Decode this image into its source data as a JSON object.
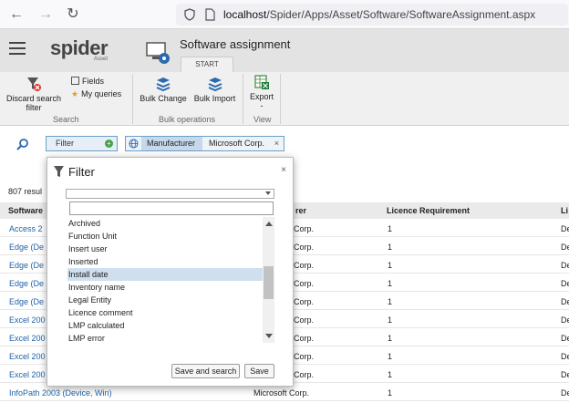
{
  "browser": {
    "url_prefix": "localhost",
    "url_path": "/Spider/Apps/Asset/Software/SoftwareAssignment.aspx"
  },
  "header": {
    "logo": "spider",
    "logo_sub": "Asset",
    "title": "Software assignment",
    "tab": "START"
  },
  "ribbon": {
    "discard_label_1": "Discard search",
    "discard_label_2": "filter",
    "fields_label": "Fields",
    "queries_label": "My queries",
    "search_group": "Search",
    "bulk_change": "Bulk Change",
    "bulk_import": "Bulk Import",
    "bulk_group": "Bulk operations",
    "export_label": "Export",
    "export_dash": "-",
    "view_group": "View"
  },
  "filterbar": {
    "filter_label": "Filter",
    "manufacturer_key": "Manufacturer",
    "manufacturer_value": "Microsoft Corp.",
    "remove": "×"
  },
  "results": {
    "count_text": "807 resul"
  },
  "grid": {
    "headers": {
      "software": "Software",
      "manufacturer": "rer",
      "licence": "Licence Requirement",
      "last": "Li"
    },
    "rows": [
      {
        "software": "Access 2",
        "manufacturer": "Corp.",
        "licence": "1",
        "last": "De"
      },
      {
        "software": "Edge (De",
        "manufacturer": "Corp.",
        "licence": "1",
        "last": "De"
      },
      {
        "software": "Edge (De",
        "manufacturer": "Corp.",
        "licence": "1",
        "last": "De"
      },
      {
        "software": "Edge (De",
        "manufacturer": "Corp.",
        "licence": "1",
        "last": "De"
      },
      {
        "software": "Edge (De",
        "manufacturer": "Corp.",
        "licence": "1",
        "last": "De"
      },
      {
        "software": "Excel 200",
        "manufacturer": "Corp.",
        "licence": "1",
        "last": "De"
      },
      {
        "software": "Excel 200",
        "manufacturer": "Corp.",
        "licence": "1",
        "last": "De"
      },
      {
        "software": "Excel 200",
        "manufacturer": "Corp.",
        "licence": "1",
        "last": "De"
      },
      {
        "software": "Excel 200",
        "manufacturer": "Corp.",
        "licence": "1",
        "last": "De"
      },
      {
        "software": "InfoPath 2003 (Device, Win)",
        "manufacturer": "Microsoft Corp.",
        "licence": "1",
        "last": "De"
      }
    ]
  },
  "dialog": {
    "title": "Filter",
    "close": "×",
    "options": [
      "Archived",
      "Function Unit",
      "Insert user",
      "Inserted",
      "Install date",
      "Inventory name",
      "Legal Entity",
      "Licence comment",
      "LMP calculated",
      "LMP error"
    ],
    "selected": "Install date",
    "save_and_search": "Save and search",
    "save": "Save"
  },
  "colors": {
    "link": "#1f62a8",
    "selected": "#cfdfee",
    "chip_border": "#6aa0c7"
  }
}
